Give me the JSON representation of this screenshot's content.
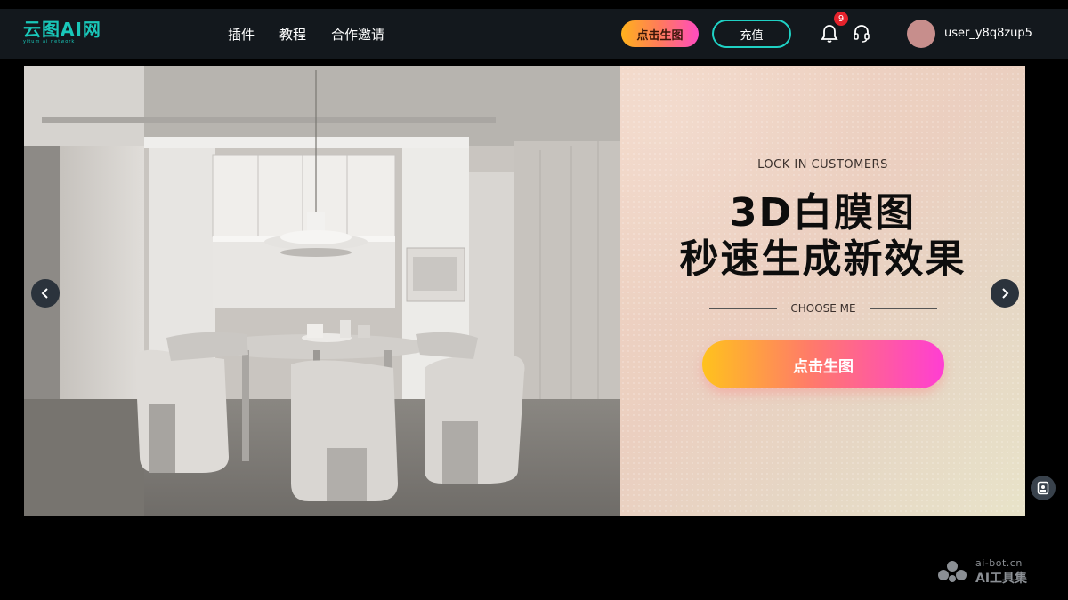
{
  "header": {
    "logo": "云图AI网",
    "logo_sub": "yitum ai network",
    "nav": [
      "插件",
      "教程",
      "合作邀请"
    ],
    "generate_label": "点击生图",
    "recharge_label": "充值",
    "notification_count": "9",
    "username": "user_y8q8zup5"
  },
  "banner": {
    "lock_text": "LOCK IN CUSTOMERS",
    "headline_line1": "3D白膜图",
    "headline_line2": "秒速生成新效果",
    "choose_text": "CHOOSE ME",
    "cta_label": "点击生图"
  },
  "watermark": {
    "line1": "ai-bot.cn",
    "line2": "AI工具集"
  },
  "colors": {
    "accent_teal": "#19c7b9",
    "header_bg": "#13181d",
    "badge_red": "#e5222c"
  }
}
